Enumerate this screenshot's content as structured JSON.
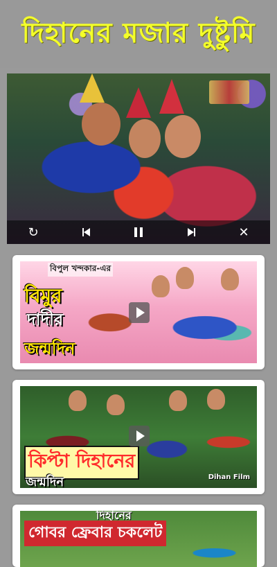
{
  "header": {
    "title": "দিহানের  মজার দুষ্টুমি",
    "title_color": "#f4ff2a",
    "background": "#999999"
  },
  "player": {
    "controls": {
      "replay_icon": "replay-icon",
      "prev_icon": "skip-previous-icon",
      "pause_icon": "pause-icon",
      "next_icon": "skip-next-icon",
      "close_icon": "close-icon"
    }
  },
  "videos": [
    {
      "small_caption": "বিপুল খন্দকার-এর",
      "line1": "বিমুর",
      "line2": "দাদীর",
      "line3": "জন্মদিন"
    },
    {
      "line1": "কিপ্টা দিহানের",
      "line2": "জন্মদিন",
      "tag": "Dihan Film"
    },
    {
      "line1": "দিহানের",
      "line2": "গোবর ফ্রেবার চকলেট"
    }
  ]
}
